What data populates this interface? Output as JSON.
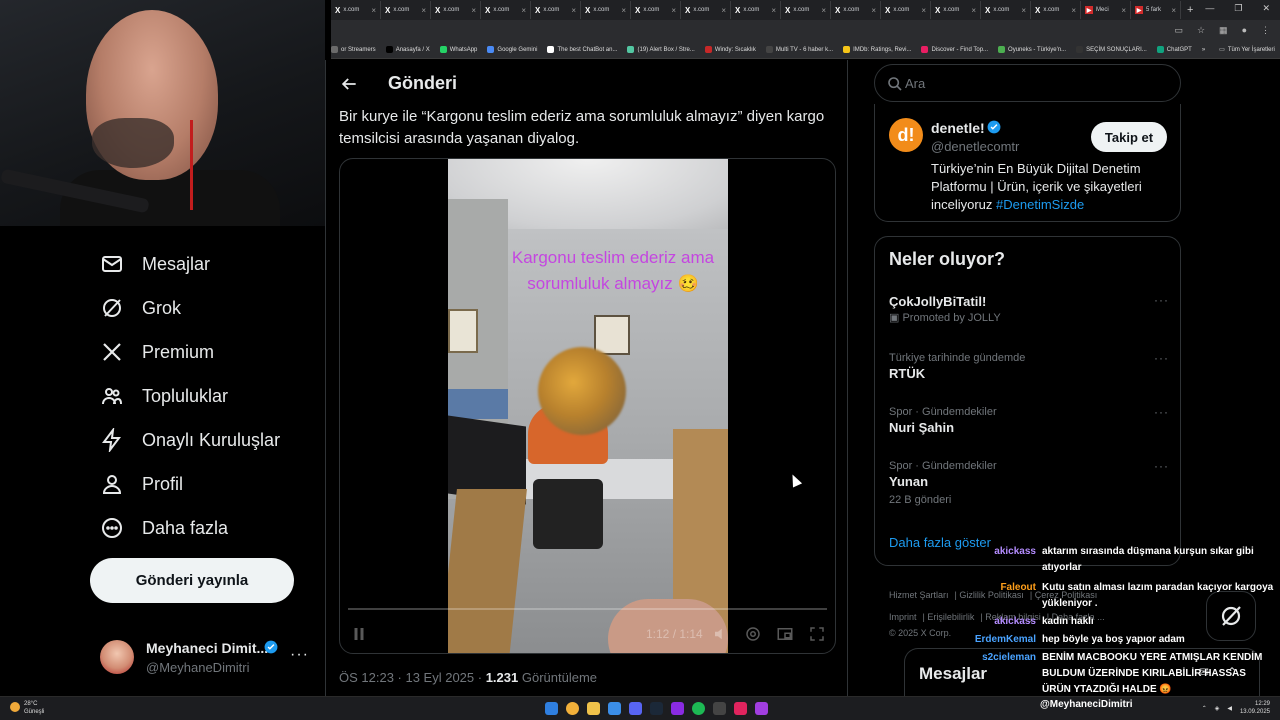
{
  "browser": {
    "tabs": [
      {
        "label": "x.com",
        "icon": "x-icon"
      },
      {
        "label": "x.com",
        "icon": "x-icon"
      },
      {
        "label": "x.com",
        "icon": "x-icon"
      },
      {
        "label": "x.com",
        "icon": "x-icon"
      },
      {
        "label": "x.com",
        "icon": "x-icon"
      },
      {
        "label": "x.com",
        "icon": "x-icon"
      },
      {
        "label": "x.com",
        "icon": "x-icon"
      },
      {
        "label": "x.com",
        "icon": "x-icon"
      },
      {
        "label": "x.com",
        "icon": "x-icon"
      },
      {
        "label": "x.com",
        "icon": "x-icon"
      },
      {
        "label": "x.com",
        "icon": "x-icon"
      },
      {
        "label": "x.com",
        "icon": "x-icon"
      },
      {
        "label": "x.com",
        "icon": "x-icon"
      },
      {
        "label": "x.com",
        "icon": "x-icon"
      },
      {
        "label": "x.com",
        "icon": "x-icon"
      },
      {
        "label": "Meci",
        "icon": "red-icon"
      },
      {
        "label": "5 fark",
        "icon": "red-icon"
      }
    ],
    "bookmarks": [
      {
        "label": "or Streamers",
        "color": "#6b6b6b"
      },
      {
        "label": "Anasayfa / X",
        "color": "#000000"
      },
      {
        "label": "WhatsApp",
        "color": "#25d366"
      },
      {
        "label": "Google Gemini",
        "color": "#4a8af4"
      },
      {
        "label": "The best ChatBot an...",
        "color": "#ffffff"
      },
      {
        "label": "(19) Alert Box / Stre...",
        "color": "#53c7a2"
      },
      {
        "label": "Windy: Sıcaklık",
        "color": "#c62828"
      },
      {
        "label": "Multi TV - 6 haber k...",
        "color": "#444444"
      },
      {
        "label": "IMDb: Ratings, Revi...",
        "color": "#f5c518"
      },
      {
        "label": "Discover - Find Top...",
        "color": "#e91e63"
      },
      {
        "label": "Oyuneks - Türkiye'n...",
        "color": "#4caf50"
      },
      {
        "label": "SEÇİM SONUÇLARI...",
        "color": "#333333"
      },
      {
        "label": "ChatGPT",
        "color": "#10a37f"
      }
    ],
    "bookmarks_more": "»",
    "all_bookmarks": "Tüm Yer İşaretleri"
  },
  "nav": {
    "items": [
      {
        "label": "Mesajlar",
        "icon": "mail-icon"
      },
      {
        "label": "Grok",
        "icon": "grok-icon"
      },
      {
        "label": "Premium",
        "icon": "x-logo-icon"
      },
      {
        "label": "Topluluklar",
        "icon": "communities-icon"
      },
      {
        "label": "Onaylı Kuruluşlar",
        "icon": "lightning-icon"
      },
      {
        "label": "Profil",
        "icon": "person-icon"
      },
      {
        "label": "Daha fazla",
        "icon": "more-circle-icon"
      }
    ],
    "post_button": "Gönderi yayınla",
    "profile": {
      "name": "Meyhaneci Dimit...",
      "handle": "@MeyhaneDimitri",
      "more": "···"
    }
  },
  "main": {
    "title": "Gönderi",
    "post_text": "Bir kurye ile “Kargonu teslim ederiz ama sorumluluk almayız” diyen kargo temsilcisi arasında yaşanan diyalog.",
    "video": {
      "caption": "Kargonu teslim ederiz ama sorumluluk almayız 🥴",
      "time": "1:12 / 1:14"
    },
    "meta": {
      "time": "ÖS 12:23 · 13 Eyl 2025 · ",
      "views": "1.231",
      "views_label": " Görüntüleme"
    }
  },
  "right": {
    "search_placeholder": "Ara",
    "account": {
      "avatar_letter": "d!",
      "name": "denetle!",
      "handle": "@denetlecomtr",
      "follow": "Takip et",
      "bio": "Türkiye’nin En Büyük Dijital Denetim Platformu | Ürün, içerik ve şikayetleri inceliyoruz ",
      "bio_tag": "#DenetimSizde"
    },
    "trends": {
      "title": "Neler oluyor?",
      "items": [
        {
          "context": "",
          "name": "ÇokJollyBiTatil!",
          "sub": "Promoted by JOLLY"
        },
        {
          "context": "Türkiye tarihinde gündemde",
          "name": "RTÜK",
          "sub": ""
        },
        {
          "context": "Spor · Gündemdekiler",
          "name": "Nuri Şahin",
          "sub": ""
        },
        {
          "context": "Spor · Gündemdekiler",
          "name": "Yunan",
          "sub": "22 B gönderi"
        }
      ],
      "more_dots": "···",
      "show_more": "Daha fazla göster"
    },
    "footer": [
      "Hizmet Şartları",
      "Gizlilik Politikası",
      "Çerez Politikası",
      "Imprint",
      "Erişilebilirlik",
      "Reklam bilgisi",
      "Daha fazla ...",
      "© 2025 X Corp."
    ],
    "dm_title": "Mesajlar"
  },
  "chat": [
    {
      "user": "akickass",
      "color": "#b48cff",
      "msg": "aktarım sırasında düşmana kurşun sıkar gibi atıyorlar"
    },
    {
      "user": "Faleout",
      "color": "#ff9f1a",
      "msg": "Kutu satın alması lazım paradan kaçıyor kargoya yükleniyor ."
    },
    {
      "user": "akickass",
      "color": "#b48cff",
      "msg": "kadın haklı"
    },
    {
      "user": "ErdemKemal",
      "color": "#4aa3ff",
      "msg": "hep böyle ya boş yapıor adam"
    },
    {
      "user": "s2cieleman",
      "color": "#4aa3ff",
      "msg": "BENİM MACBOOKU YERE ATMIŞLAR KENDİM BULDUM ÜZERİNDE KIRILABİLİR HASSAS ÜRÜN YTAZDIĞI HALDE 😡"
    }
  ],
  "chat_footer": "@MeyhaneciDimitri",
  "taskbar": {
    "weather_temp": "28°C",
    "weather_desc": "Güneşli",
    "clock_time": "12:29",
    "clock_date": "13.09.2025"
  },
  "colors": {
    "accent": "#1d9bf0",
    "bg": "#000000",
    "text": "#e7e9ea",
    "muted": "#71767b"
  }
}
